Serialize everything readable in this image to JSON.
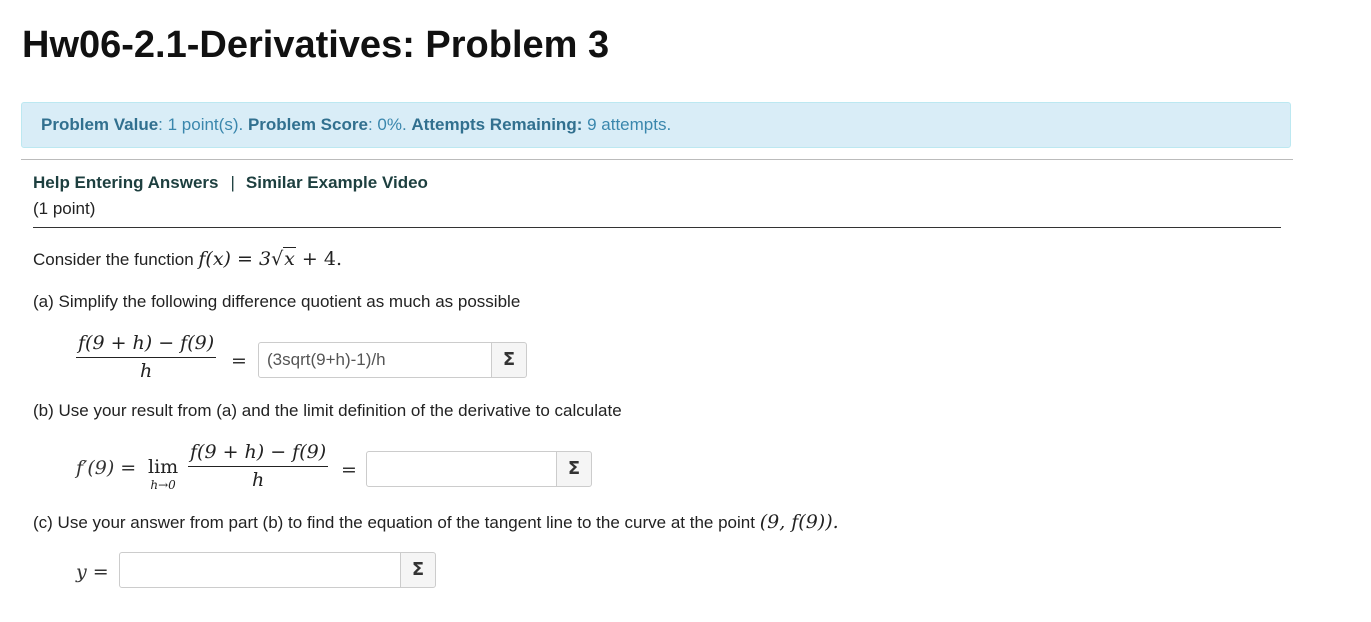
{
  "page": {
    "title": "Hw06-2.1-Derivatives: Problem 3"
  },
  "info": {
    "value_label": "Problem Value",
    "value_text": ": 1 point(s). ",
    "score_label": "Problem Score",
    "score_text": ": 0%. ",
    "attempts_label": "Attempts Remaining:",
    "attempts_text": " 9 attempts."
  },
  "links": {
    "help": "Help Entering Answers",
    "separator": "|",
    "video": "Similar Example Video"
  },
  "points": "(1 point)",
  "problem": {
    "intro": "Consider the function ",
    "function_lhs": "f(x) = 3",
    "function_rad": "x",
    "function_rhs": " + 4.",
    "part_a": "(a)  Simplify the following difference quotient as much as possible",
    "part_b": "(b)  Use your result from (a) and the limit definition of the derivative to calculate",
    "part_c": "(c)  Use your answer from part (b) to find the equation of the tangent line to the curve at the point ",
    "part_c_point": "(9, f(9)).",
    "quotient_num": "f(9 + h) − f(9)",
    "quotient_den": "h",
    "equals": "=",
    "deriv_lhs": "f′(9) =",
    "lim_word": "lim",
    "lim_sub": "h→0",
    "y_label": "y ="
  },
  "answers": {
    "a_value": "(3sqrt(9+h)-1)/h",
    "b_value": "",
    "c_value": ""
  },
  "sigma_symbol": "Σ"
}
